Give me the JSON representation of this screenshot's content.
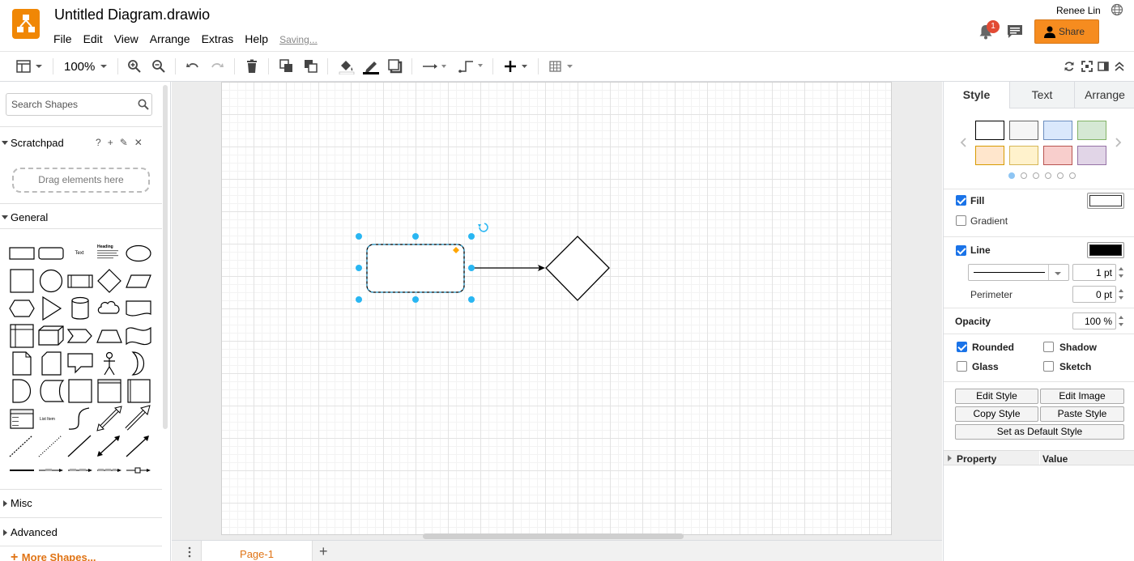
{
  "header": {
    "title": "Untitled Diagram.drawio",
    "menus": [
      "File",
      "Edit",
      "View",
      "Arrange",
      "Extras",
      "Help"
    ],
    "saving_status": "Saving...",
    "user_name": "Renee Lin",
    "notification_count": "1",
    "share_label": "Share"
  },
  "toolbar": {
    "zoom": "100%"
  },
  "sidebar": {
    "search_placeholder": "Search Shapes",
    "scratchpad_title": "Scratchpad",
    "scratchpad_tools": [
      "?",
      "+",
      "✎",
      "✕"
    ],
    "drag_hint": "Drag elements here",
    "general_title": "General",
    "shape_text_label": "Text",
    "shape_heading_label": "Heading",
    "shape_list_item_label": "List Item",
    "misc_title": "Misc",
    "advanced_title": "Advanced",
    "more_shapes": "More Shapes..."
  },
  "pages": {
    "tabs": [
      "Page-1"
    ]
  },
  "format_panel": {
    "tabs": [
      "Style",
      "Text",
      "Arrange"
    ],
    "swatches": [
      {
        "fill": "#ffffff",
        "stroke": "#000000"
      },
      {
        "fill": "#f5f5f5",
        "stroke": "#666666"
      },
      {
        "fill": "#dae8fc",
        "stroke": "#6c8ebf"
      },
      {
        "fill": "#d5e8d4",
        "stroke": "#82b366"
      },
      {
        "fill": "#ffe6cc",
        "stroke": "#d79b00"
      },
      {
        "fill": "#fff2cc",
        "stroke": "#d6b656"
      },
      {
        "fill": "#f8cecc",
        "stroke": "#b85450"
      },
      {
        "fill": "#e1d5e7",
        "stroke": "#9673a6"
      }
    ],
    "fill_label": "Fill",
    "fill_checked": true,
    "fill_color": "#ffffff",
    "gradient_label": "Gradient",
    "gradient_checked": false,
    "line_label": "Line",
    "line_checked": true,
    "line_color": "#000000",
    "line_width": "1 pt",
    "perimeter_label": "Perimeter",
    "perimeter_value": "0 pt",
    "opacity_label": "Opacity",
    "opacity_value": "100 %",
    "rounded_label": "Rounded",
    "rounded_checked": true,
    "shadow_label": "Shadow",
    "shadow_checked": false,
    "glass_label": "Glass",
    "glass_checked": false,
    "sketch_label": "Sketch",
    "sketch_checked": false,
    "buttons": {
      "edit_style": "Edit Style",
      "edit_image": "Edit Image",
      "copy_style": "Copy Style",
      "paste_style": "Paste Style",
      "set_default": "Set as Default Style"
    },
    "property_header": "Property",
    "value_header": "Value"
  },
  "colors": {
    "accent": "#f08705",
    "selection": "#29b6f2",
    "checkbox": "#1a73e8",
    "link": "#e07314"
  }
}
